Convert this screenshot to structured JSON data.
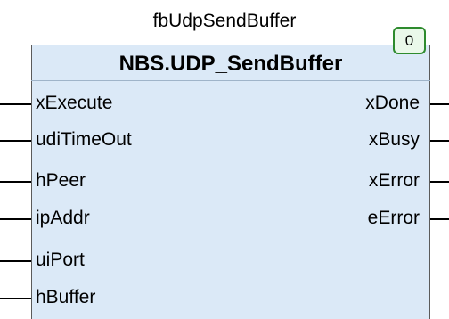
{
  "block": {
    "instance_name": "fbUdpSendBuffer",
    "type_name": "NBS.UDP_SendBuffer",
    "execution_order": "0"
  },
  "inputs": [
    "xExecute",
    "udiTimeOut",
    "hPeer",
    "ipAddr",
    "uiPort",
    "hBuffer"
  ],
  "outputs": [
    "xDone",
    "xBusy",
    "xError",
    "eError"
  ],
  "colors": {
    "block_fill": "#dbe9f7",
    "block_border": "#5b5b5b",
    "badge_border": "#2e8b2e",
    "badge_fill": "#eaf8ea"
  }
}
